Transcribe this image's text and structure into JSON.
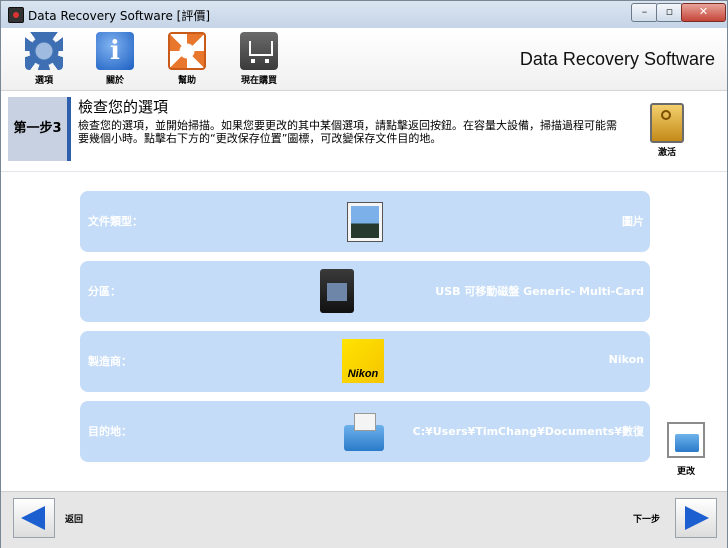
{
  "window": {
    "title": "Data Recovery Software [評價]",
    "min_label": "–",
    "max_label": "▫",
    "close_label": "✕"
  },
  "toolbar": {
    "items": [
      {
        "label": "選項",
        "icon": "gear-icon"
      },
      {
        "label": "關於",
        "icon": "info-icon"
      },
      {
        "label": "幫助",
        "icon": "lifebuoy-icon"
      },
      {
        "label": "現在購買",
        "icon": "cart-icon"
      }
    ],
    "app_title": "Data Recovery Software"
  },
  "step": {
    "badge": "第一步3",
    "title": "檢查您的選項",
    "description": "檢查您的選項，並開始掃描。如果您要更改的其中某個選項，請點擊返回按鈕。在容量大設備，掃描過程可能需要幾個小時。點擊右下方的“更改保存位置”圖標，可改變保存文件目的地。",
    "activate_label": "激活"
  },
  "rows": [
    {
      "key": "文件類型：",
      "value": "圖片",
      "icon": "photo-icon"
    },
    {
      "key": "分區：",
      "value": "USB 可移動磁盤 Generic- Multi-Card",
      "icon": "memory-card-icon"
    },
    {
      "key": "製造商：",
      "value": "Nikon",
      "icon": "nikon-logo-icon"
    },
    {
      "key": "目的地：",
      "value": "C:¥Users¥TimChang¥Documents¥數復",
      "icon": "folder-icon"
    }
  ],
  "nikon_logo_text": "Nikon",
  "change_label": "更改",
  "nav": {
    "back_label": "返回",
    "next_label": "下一步"
  },
  "colors": {
    "row_bg": "#c4dcf7",
    "accent": "#2e5fad",
    "arrow": "#1b5fd0"
  }
}
